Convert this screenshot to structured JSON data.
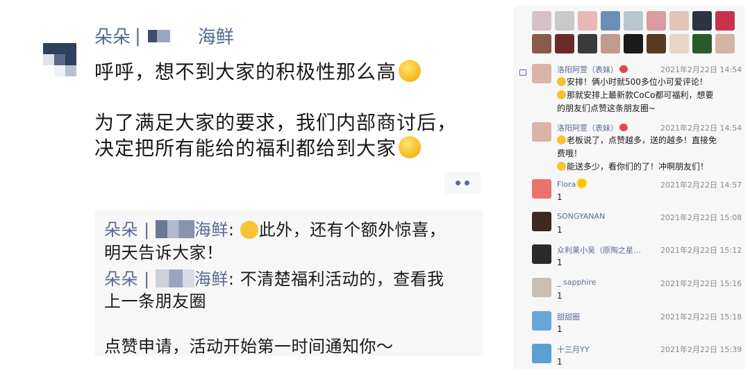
{
  "post": {
    "poster_name": "朵朵",
    "poster_sep": "|",
    "poster_suffix": "海鲜",
    "lines": [
      "呼呼，想不到大家的积极性那么高",
      "为了满足大家的要求，我们内部商讨后，",
      "决定把所有能给的福利都给到大家"
    ],
    "comments": [
      {
        "name_prefix": "朵朵 |",
        "name_suffix": "海鲜",
        "colon": ": ",
        "text1": "此外，还有个额外惊喜，",
        "text2": "明天告诉大家！"
      },
      {
        "name_prefix": "朵朵 |",
        "name_suffix": "海鲜",
        "colon": ": ",
        "text1": "不清楚福利活动的，查看我",
        "text2": "上一条朋友圈",
        "text3": "点赞申请，活动开始第一时间通知你～"
      }
    ]
  },
  "panel": {
    "like_avatars_row1": [
      "#d8c0c8",
      "#c9c9c9",
      "#e8b9b4",
      "#6a8fb7",
      "#b7c7d0",
      "#d99ca0",
      "#e3c5b5",
      "#2c3440",
      "#c8324a"
    ],
    "like_avatars_row2": [
      "#8a5a4a",
      "#6b2a2a",
      "#3a3a3a",
      "#c29a8a",
      "#1b1b1b",
      "#5a3a20",
      "#e6d6c6",
      "#2a5a2a",
      "#d4b4a4"
    ],
    "entries": [
      {
        "name": "洛阳阿萱（表妹）",
        "time": "2021年2月22日 14:54",
        "lines": [
          "安排！俩小时就500多位小可爱评论！",
          "那就安排上最新款CoCo都可福利，想要",
          "的朋友们点赞这条朋友圈~"
        ],
        "avatar_color": "#d9b5a8"
      },
      {
        "name": "洛阳阿萱（表妹）",
        "time": "2021年2月22日 14:54",
        "lines": [
          "老板说了，点赞越多，送的越多！直接免",
          "费哦！",
          "能送多少，看你们的了！冲啊朋友们！"
        ],
        "avatar_color": "#d9b5a8"
      },
      {
        "name": "Flora",
        "time": "2021年2月22日 14:57",
        "lines": [
          "1"
        ],
        "avatar_color": "#e9736a"
      },
      {
        "name": "SONGYANAN",
        "time": "2021年2月22日 15:08",
        "lines": [
          "1"
        ],
        "avatar_color": "#3b2a22"
      },
      {
        "name": "众利莱小吴（原陶之星…",
        "time": "2021年2月22日 15:12",
        "lines": [
          "1"
        ],
        "avatar_color": "#2a2a2a"
      },
      {
        "name": "_ sapphire",
        "time": "2021年2月22日 15:16",
        "lines": [
          "1"
        ],
        "avatar_color": "#c9bfb2"
      },
      {
        "name": "甜甜圈",
        "time": "2021年2月22日 15:18",
        "lines": [
          "1"
        ],
        "avatar_color": "#6aa5d8"
      },
      {
        "name": "十三月YY",
        "time": "2021年2月22日 15:39",
        "lines": [
          "1"
        ],
        "avatar_color": "#5aa0d0"
      }
    ]
  }
}
